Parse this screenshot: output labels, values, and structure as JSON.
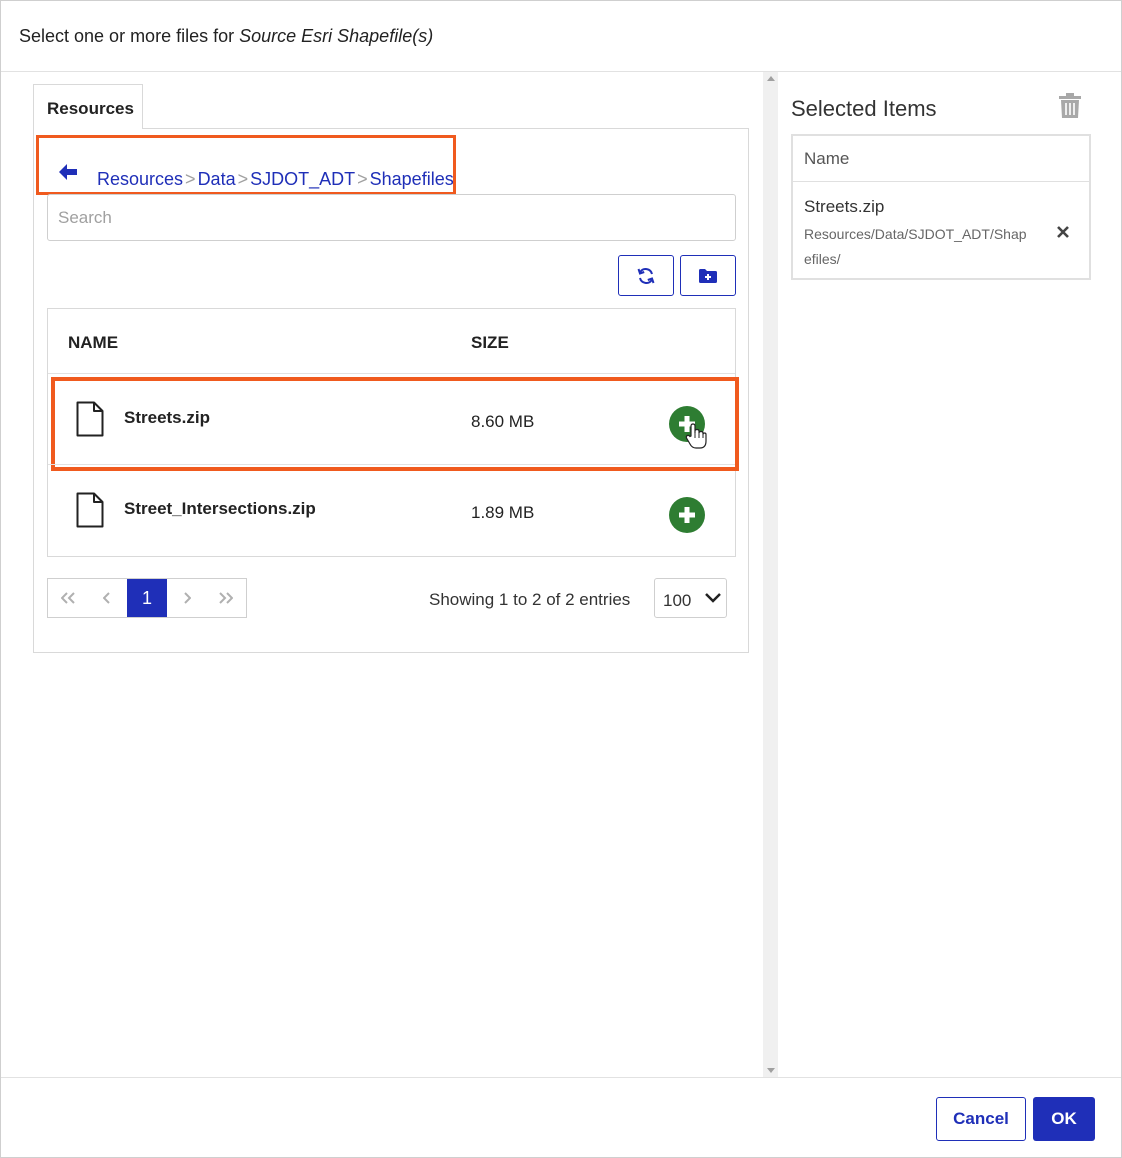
{
  "header": {
    "title_prefix": "Select one or more files for ",
    "title_target": "Source Esri Shapefile(s)"
  },
  "tabs": [
    {
      "label": "Resources",
      "active": true
    }
  ],
  "breadcrumb": {
    "items": [
      "Resources",
      "Data",
      "SJDOT_ADT",
      "Shapefiles"
    ],
    "separator": ">"
  },
  "search": {
    "placeholder": "Search",
    "value": ""
  },
  "toolbar": {
    "refresh_icon": "refresh-icon",
    "new_folder_icon": "folder-plus-icon"
  },
  "table": {
    "columns": [
      "NAME",
      "SIZE"
    ],
    "rows": [
      {
        "name": "Streets.zip",
        "size": "8.60 MB",
        "highlighted": true
      },
      {
        "name": "Street_Intersections.zip",
        "size": "1.89 MB",
        "highlighted": false
      }
    ]
  },
  "pagination": {
    "current_page": "1",
    "info": "Showing 1 to 2 of 2 entries",
    "page_size": "100"
  },
  "selected": {
    "title": "Selected Items",
    "column": "Name",
    "items": [
      {
        "name": "Streets.zip",
        "path": "Resources/Data/SJDOT_ADT/Shapefiles/"
      }
    ]
  },
  "footer": {
    "cancel_label": "Cancel",
    "ok_label": "OK"
  },
  "colors": {
    "primary": "#1f2fb8",
    "highlight": "#f05a1e",
    "add": "#2e7d32"
  }
}
